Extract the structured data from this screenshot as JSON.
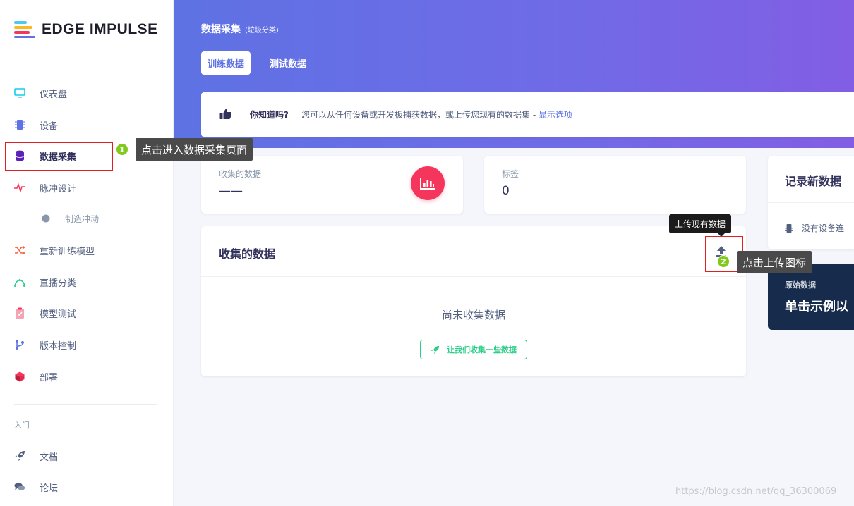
{
  "app": {
    "logo_text": "EDGE IMPULSE"
  },
  "sidebar": {
    "items": [
      {
        "label": "仪表盘",
        "icon": "monitor-icon"
      },
      {
        "label": "设备",
        "icon": "chip-icon"
      },
      {
        "label": "数据采集",
        "icon": "database-icon"
      },
      {
        "label": "脉冲设计",
        "icon": "pulse-icon"
      },
      {
        "label": "制造冲动",
        "icon": "dot-icon"
      },
      {
        "label": "重新训练模型",
        "icon": "shuffle-icon"
      },
      {
        "label": "直播分类",
        "icon": "curve-icon"
      },
      {
        "label": "模型测试",
        "icon": "clipboard-check-icon"
      },
      {
        "label": "版本控制",
        "icon": "branch-icon"
      },
      {
        "label": "部署",
        "icon": "cube-icon"
      }
    ],
    "section_label": "入门",
    "footer_items": [
      {
        "label": "文档",
        "icon": "rocket-icon"
      },
      {
        "label": "论坛",
        "icon": "chat-icon"
      }
    ]
  },
  "header": {
    "title": "数据采集",
    "subtitle": "(垃圾分类)",
    "tabs": [
      {
        "label": "训练数据",
        "active": true
      },
      {
        "label": "测试数据",
        "active": false
      }
    ]
  },
  "info": {
    "title": "你知道吗?",
    "body": "您可以从任何设备或开发板捕获数据，或上传您现有的数据集 - ",
    "link": "显示选项"
  },
  "stats": [
    {
      "label": "收集的数据",
      "value": "——"
    },
    {
      "label": "标签",
      "value": "0"
    }
  ],
  "collected": {
    "title": "收集的数据",
    "empty_text": "尚未收集数据",
    "collect_button": "让我们收集一些数据",
    "upload_tooltip": "上传现有数据"
  },
  "record": {
    "title": "记录新数据",
    "no_device": "没有设备连"
  },
  "raw": {
    "label": "原始数据",
    "text": "单击示例以"
  },
  "annotations": {
    "step1_number": "1",
    "step1_text": "点击进入数据采集页面",
    "step2_number": "2",
    "step2_text": "点击上传图标"
  },
  "watermark": "https://blog.csdn.net/qq_36300069",
  "colors": {
    "accent": "#5e72e4",
    "gradient_end": "#825ee4",
    "stat_icon": "#f5365c",
    "success": "#2dce89",
    "raw_bg": "#172b4d",
    "highlight": "#e02020",
    "badge": "#82c91e"
  }
}
